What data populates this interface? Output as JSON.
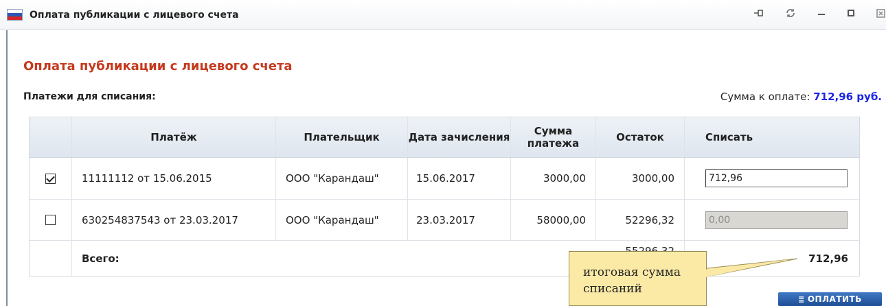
{
  "window": {
    "title": "Оплата публикации с лицевого счета",
    "controls": [
      "pin-icon",
      "refresh-icon",
      "minimize-icon",
      "maximize-icon",
      "close-icon"
    ]
  },
  "page": {
    "heading": "Оплата публикации с лицевого счета",
    "section_label": "Платежи для списания:",
    "sum_label": "Сумма к оплате:",
    "sum_value": "712,96 руб."
  },
  "table": {
    "headers": {
      "payment": "Платёж",
      "payer": "Плательщик",
      "date": "Дата зачисления",
      "amount": "Сумма платежа",
      "remainder": "Остаток",
      "writeoff": "Списать"
    },
    "rows": [
      {
        "checked": true,
        "payment": "11111112 от 15.06.2015",
        "payer": "ООО \"Карандаш\"",
        "date": "15.06.2017",
        "amount": "3000,00",
        "remainder": "3000,00",
        "writeoff": "712,96"
      },
      {
        "checked": false,
        "payment": "630254837543 от 23.03.2017",
        "payer": "ООО \"Карандаш\"",
        "date": "23.03.2017",
        "amount": "58000,00",
        "remainder": "52296,32",
        "writeoff": "0,00"
      }
    ],
    "total_label": "Всего:",
    "total_remainder_partial": "55296,32",
    "total_writeoff": "712,96"
  },
  "callout": {
    "text": "итоговая сумма списаний"
  },
  "pay_button": {
    "label": "ОПЛАТИТЬ"
  },
  "colors": {
    "heading": "#c5391c",
    "sum_value": "#1b25e6",
    "callout_bg": "#fbeaa6",
    "button": "#2a5ea8"
  }
}
